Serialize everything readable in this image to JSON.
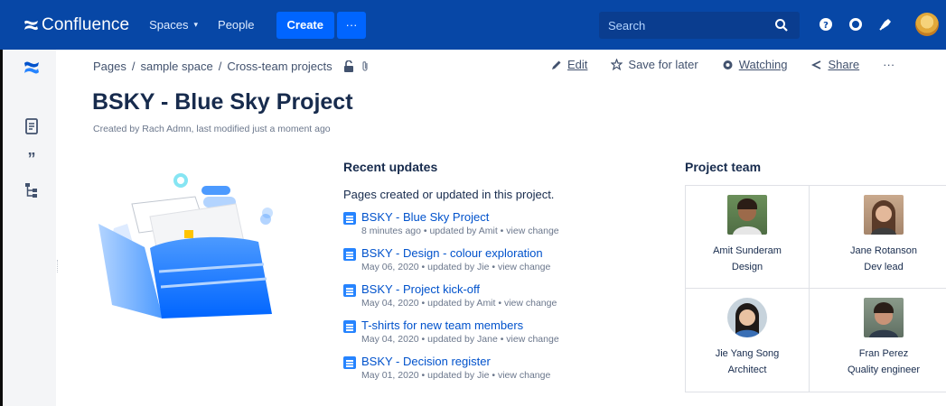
{
  "topnav": {
    "brand": "Confluence",
    "spaces": "Spaces",
    "people": "People",
    "create": "Create",
    "more": "···",
    "search_placeholder": "Search",
    "icons": [
      "search-icon",
      "help-icon",
      "settings-icon",
      "notifications-icon",
      "user-avatar"
    ]
  },
  "sidebar": {
    "icons": [
      "confluence-logo-icon",
      "pages-icon",
      "blog-quote-icon",
      "page-tree-icon"
    ]
  },
  "breadcrumb": [
    "Pages",
    "sample space",
    "Cross-team projects"
  ],
  "actions": {
    "edit": "Edit",
    "save_for_later": "Save for later",
    "watching": "Watching",
    "share": "Share",
    "more": "···"
  },
  "page": {
    "title": "BSKY - Blue Sky Project",
    "byline": "Created by Rach Admn, last modified just a moment ago"
  },
  "recent_updates": {
    "title": "Recent updates",
    "description": "Pages created or updated in this project.",
    "items": [
      {
        "title": "BSKY - Blue Sky Project",
        "meta": "8 minutes ago • updated by Amit • view change"
      },
      {
        "title": "BSKY - Design - colour exploration",
        "meta": "May 06, 2020 • updated by Jie • view change"
      },
      {
        "title": "BSKY - Project kick-off",
        "meta": "May 04, 2020 • updated by Amit • view change"
      },
      {
        "title": "T-shirts for new team members",
        "meta": "May 04, 2020 • updated by Jane • view change"
      },
      {
        "title": "BSKY - Decision register",
        "meta": "May 01, 2020 • updated by Jie • view change"
      }
    ]
  },
  "project_team": {
    "title": "Project team",
    "members": [
      {
        "name": "Amit Sunderam",
        "role": "Design"
      },
      {
        "name": "Jane Rotanson",
        "role": "Dev lead"
      },
      {
        "name": "Jie Yang Song",
        "role": "Architect"
      },
      {
        "name": "Fran Perez",
        "role": "Quality engineer"
      }
    ]
  },
  "colors": {
    "nav_bg": "#0747a6",
    "accent": "#0052cc",
    "create_btn": "#0065ff"
  }
}
